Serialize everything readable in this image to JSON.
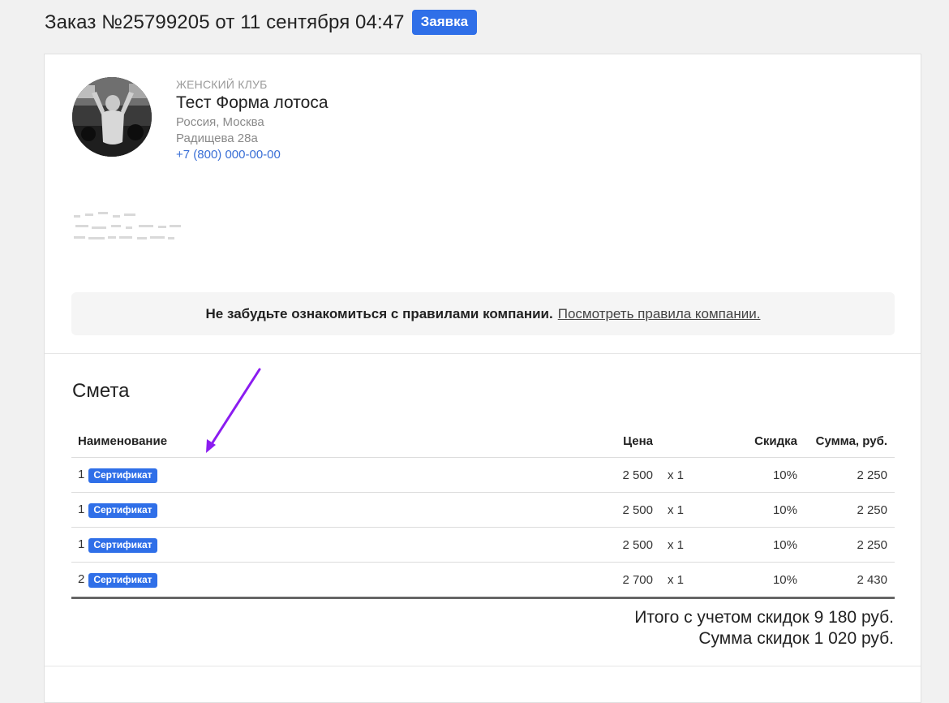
{
  "header": {
    "title": "Заказ №25799205 от 11 сентября 04:47",
    "status_badge": "Заявка"
  },
  "club": {
    "category": "ЖЕНСКИЙ КЛУБ",
    "name": "Тест Форма лотоса",
    "country": "Россия, Москва",
    "address": "Радищева 28а",
    "phone": "+7 (800) 000-00-00"
  },
  "rules_banner": {
    "text": "Не забудьте ознакомиться с правилами компании.",
    "link": "Посмотреть правила компании."
  },
  "estimate": {
    "title": "Смета",
    "columns": {
      "name": "Наименование",
      "price": "Цена",
      "discount": "Скидка",
      "sum": "Сумма, руб."
    },
    "rows": [
      {
        "count": "1",
        "item": "Сертификат",
        "price": "2 500",
        "qty": "x 1",
        "discount": "10%",
        "sum": "2 250"
      },
      {
        "count": "1",
        "item": "Сертификат",
        "price": "2 500",
        "qty": "x 1",
        "discount": "10%",
        "sum": "2 250"
      },
      {
        "count": "1",
        "item": "Сертификат",
        "price": "2 500",
        "qty": "x 1",
        "discount": "10%",
        "sum": "2 250"
      },
      {
        "count": "2",
        "item": "Сертификат",
        "price": "2 700",
        "qty": "x 1",
        "discount": "10%",
        "sum": "2 430"
      }
    ],
    "total_with_discount": "Итого с учетом скидок 9 180 руб.",
    "discount_total": "Сумма скидок 1 020 руб."
  },
  "colors": {
    "accent": "#2f6fe8",
    "annotation_arrow": "#8b1cf0"
  }
}
